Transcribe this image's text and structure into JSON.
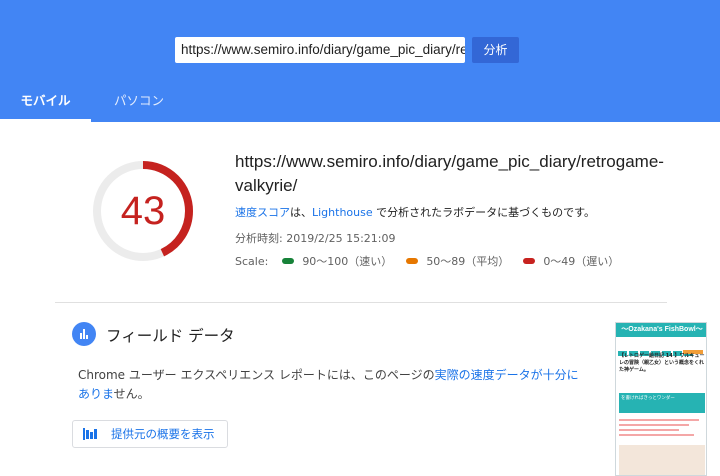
{
  "search": {
    "url_value": "https://www.semiro.info/diary/game_pic_diary/retrogame-valkyrie/",
    "analyze_label": "分析"
  },
  "tabs": [
    {
      "label": "モバイル"
    },
    {
      "label": "パソコン"
    }
  ],
  "score": {
    "value": "43",
    "progress": 0.43,
    "color": "#c5221f"
  },
  "result": {
    "url_line1": "https://www.semiro.info/diary/game_pic_diary/retrogame-",
    "url_line2": "valkyrie/",
    "desc_link1": "速度スコア",
    "desc_mid": "は、",
    "desc_link2": "Lighthouse",
    "desc_tail": " で分析されたラボデータに基づくものです。",
    "analysis_time": "分析時刻: 2019/2/25 15:21:09",
    "scale_label": "Scale:",
    "scale": [
      {
        "label": "90～100（速い）",
        "color": "#178239"
      },
      {
        "label": "50～89（平均）",
        "color": "#e67700"
      },
      {
        "label": "0～49（遅い）",
        "color": "#c7221f"
      }
    ]
  },
  "field": {
    "title": "フィールド データ",
    "text_before": "Chrome ユーザー エクスペリエンス レポートには、このページの",
    "text_link": "実際の速度データが十分にありま",
    "text_after": "せん。",
    "origin_button": "提供元の概要を表示"
  },
  "thumbnail": {
    "header": "～Ozakana's FishBowl～",
    "title": "【レトロゲー絵日記 14 】ワルキューレの冒険（親乙女）という概念をくれた神ゲーム。",
    "box_text": "を書ければきっとワンダー"
  }
}
